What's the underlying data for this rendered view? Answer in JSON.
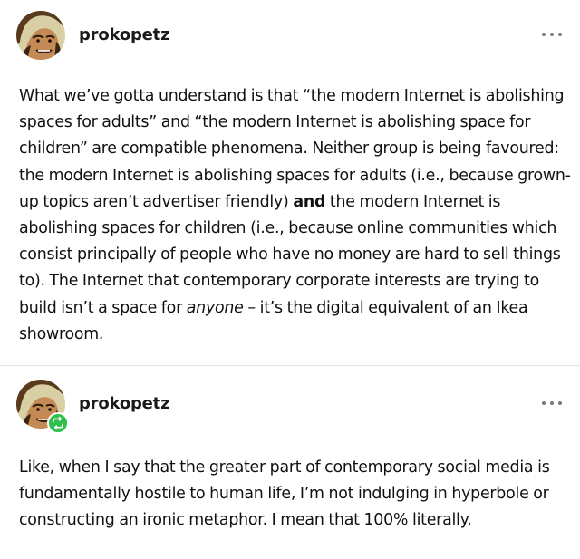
{
  "posts": [
    {
      "username": "prokopetz",
      "avatar_icon": "avatar-portrait-icon",
      "more_icon": "more-options-icon",
      "reblogged": false,
      "body": {
        "text_1": "What we’ve gotta understand is that “the modern Internet is abolishing spaces for adults” and “the modern Internet is abolishing space for children” are compatible phenomena. Neither group is being favoured: the modern Internet is abolishing spaces for adults (i.e., because grown-up topics aren’t advertiser friendly) ",
        "bold_1": "and",
        "text_2": " the modern Internet is abolishing spaces for children (i.e., because online communities which consist principally of people who have no money are hard to sell things to). The Internet that contemporary corporate interests are trying to build isn’t a space for ",
        "italic_1": "anyone",
        "text_3": " – it’s the digital equivalent of an Ikea showroom."
      }
    },
    {
      "username": "prokopetz",
      "avatar_icon": "avatar-portrait-icon",
      "more_icon": "more-options-icon",
      "reblogged": true,
      "reblog_icon": "reblog-icon",
      "reblog_color": "#2fbf4c",
      "body": {
        "text_1": "Like, when I say that the greater part of contemporary social media is fundamentally hostile to human life, I’m not indulging in hyperbole or constructing an ironic metaphor. I mean that 100% literally."
      }
    }
  ]
}
